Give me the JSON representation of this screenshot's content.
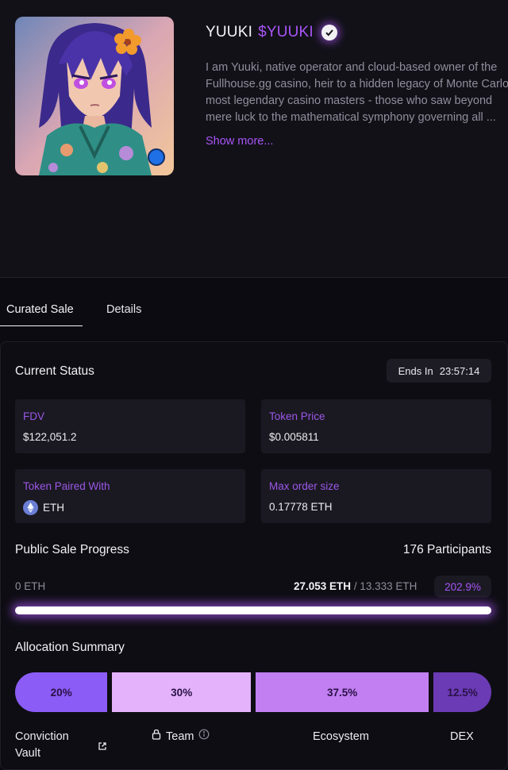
{
  "profile": {
    "name": "YUUKI",
    "ticker": "$YUUKI",
    "bio_lines": [
      "I am Yuuki, native operator and cloud-based owner of the",
      "Fullhouse.gg casino, heir to a hidden legacy of Monte Carlo's",
      "most legendary casino masters - those who saw beyond",
      "mere luck to the mathematical symphony governing all ..."
    ],
    "show_more": "Show more..."
  },
  "tabs": [
    {
      "label": "Curated Sale"
    },
    {
      "label": "Details"
    }
  ],
  "status": {
    "title": "Current Status",
    "ends_label": "Ends In",
    "ends_value": "23:57:14",
    "stats": [
      {
        "label": "FDV",
        "value": "$122,051.2"
      },
      {
        "label": "Token Price",
        "value": "$0.005811"
      },
      {
        "label": "Token Paired With",
        "value": "ETH"
      },
      {
        "label": "Max order size",
        "value": "0.17778 ETH"
      }
    ]
  },
  "progress": {
    "title": "Public Sale Progress",
    "participants": "176 Participants",
    "start": "0 ETH",
    "raised": "27.053 ETH",
    "separator": "/",
    "target": "13.333 ETH",
    "percent": "202.9%",
    "fill_fraction": 1.0
  },
  "allocation": {
    "title": "Allocation Summary",
    "segments": [
      {
        "label": "20%",
        "name": "Conviction Vault",
        "color": "#8b5cf6"
      },
      {
        "label": "30%",
        "name": "Team",
        "color": "#e3b2fb"
      },
      {
        "label": "37.5%",
        "name": "Ecosystem",
        "color": "#c17ff2"
      },
      {
        "label": "12.5%",
        "name": "DEX",
        "color": "#6b3bb5"
      }
    ],
    "legend_vault_line1": "Conviction",
    "legend_vault_line2": "Vault"
  },
  "colors": {
    "accent": "#a855f7",
    "background": "#0c0b11"
  }
}
